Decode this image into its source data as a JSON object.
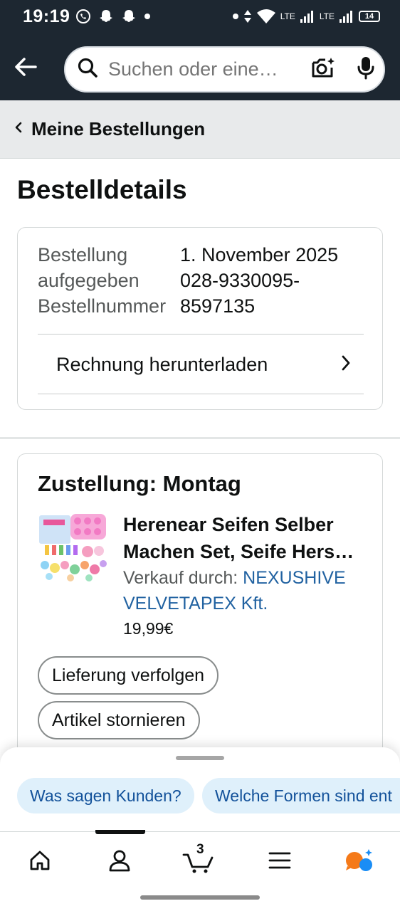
{
  "status_bar": {
    "time": "19:19",
    "network_1": "LTE",
    "network_2": "LTE",
    "battery": "14"
  },
  "search": {
    "placeholder": "Suchen oder eine…"
  },
  "breadcrumb": {
    "label": "Meine Bestellungen"
  },
  "page_title": "Bestelldetails",
  "order": {
    "labels": [
      "Bestellung",
      "aufgegeben",
      "Bestellnummer"
    ],
    "values": [
      "1. November 2025",
      "028-9330095-",
      "8597135"
    ],
    "invoice_label": "Rechnung herunterladen"
  },
  "delivery": {
    "title": "Zustellung: Montag",
    "product_name": "Herenear Seifen Selber Machen Set, Seife Hers…",
    "seller_prefix": "Verkauf durch: ",
    "seller_name": "NEXUSHIVE VELVETAPEX Kft.",
    "price": "19,99€",
    "buttons": [
      "Lieferung verfolgen",
      "Artikel stornieren"
    ]
  },
  "suggestions": [
    "Was sagen Kunden?",
    "Welche Formen sind ent"
  ],
  "nav": {
    "cart_count": "3",
    "items": [
      "home-icon",
      "account-icon",
      "cart-icon",
      "menu-icon",
      "rufus-icon"
    ]
  },
  "colors": {
    "header_bg": "#1d2731",
    "link": "#2162a1",
    "chip_bg": "#dff0fb",
    "chip_text": "#12519a",
    "rufus_orange": "#f57a19",
    "rufus_blue": "#1a8df5"
  }
}
